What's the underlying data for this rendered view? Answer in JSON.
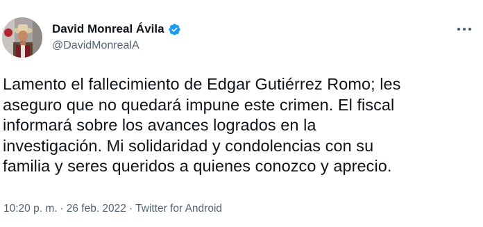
{
  "author": {
    "display_name": "David Monreal Ávila",
    "handle": "@DavidMonrealA",
    "verified": true,
    "avatar_icon": "profile-photo-avatar"
  },
  "tweet": {
    "text": "Lamento el fallecimiento de Edgar Gutiérrez Romo; les\naseguro que no quedará impune este crimen. El fiscal\ninformará sobre los avances logrados en la\ninvestigación. Mi solidaridad y condolencias con su\nfamilia y seres queridos a quienes conozco y aprecio."
  },
  "meta": {
    "time": "10:20 p. m.",
    "separator": "·",
    "date": "26 feb. 2022",
    "source": "Twitter for Android"
  },
  "icons": {
    "verified": "verified-badge-icon",
    "more": "more-options-icon"
  },
  "colors": {
    "verified_blue": "#1d9bf0",
    "text_primary": "#0f1419",
    "text_secondary": "#536471"
  }
}
